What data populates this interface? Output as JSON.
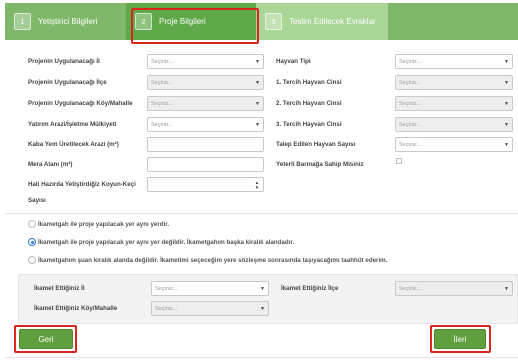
{
  "tabs": [
    {
      "num": "1",
      "label": "Yetiştirici Bilgileri"
    },
    {
      "num": "2",
      "label": "Proje Bilgileri"
    },
    {
      "num": "3",
      "label": "Teslim Edilecek Evraklar"
    }
  ],
  "left_fields": [
    {
      "label": "Projenin Uygulanacağı İl",
      "value": "Seçiniz...",
      "disabled": false
    },
    {
      "label": "Projenin Uygulanacağı İlçe",
      "value": "Seçiniz...",
      "disabled": true
    },
    {
      "label": "Projenin Uygulanacağı Köy/Mahalle",
      "value": "Seçiniz...",
      "disabled": true
    },
    {
      "label": "Yatırım Arazi/İşletme Mülkiyeti",
      "value": "Seçiniz...",
      "disabled": false
    }
  ],
  "left_inputs": {
    "kaba_yem": "Kaba Yem Üretilecek Arazi (m²)",
    "mera": "Mera Alanı (m²)",
    "hali_hazirda_line1": "Hali Hazırda Yetiştirdiğiz Koyun-Keçi",
    "hali_hazirda_line2": "Sayısı"
  },
  "right_fields": [
    {
      "label": "Hayvan Tipi",
      "value": "Seçiniz...",
      "disabled": false
    },
    {
      "label": "1. Tercih Hayvan Cinsi",
      "value": "Seçiniz...",
      "disabled": true
    },
    {
      "label": "2. Tercih Hayvan Cinsi",
      "value": "Seçiniz...",
      "disabled": true
    },
    {
      "label": "3. Tercih Hayvan Cinsi",
      "value": "Seçiniz...",
      "disabled": true
    },
    {
      "label": "Talep Edilen Hayvan Sayısı",
      "value": "Seçiniz...",
      "disabled": false
    }
  ],
  "yeterli_barinak": {
    "label": "Yeterli Barınağa Sahip Misiniz",
    "checked": false
  },
  "radios": [
    {
      "label": "İkametgah ile proje yapılacak yer aynı yerdir.",
      "checked": false
    },
    {
      "label": "İkametgah ile proje yapılacak yer aynı yer değildir. İkametgahım başka kiralık alandadır.",
      "checked": true
    },
    {
      "label": "İkametgahım şuan kiralık alanda değildir. İkametimi seçeceğim yere sözleşme sonrasında taşıyacağımı taahhüt ederim.",
      "checked": false
    }
  ],
  "ikamet": {
    "il": {
      "label": "İkamet Ettiğiniz İl",
      "value": "Seçiniz..."
    },
    "ilce": {
      "label": "İkamet Ettiğiniz İlçe",
      "value": "Seçiniz..."
    },
    "koy": {
      "label": "İkamet Ettiğiniz Köy/Mahalle",
      "value": "Seçiniz..."
    }
  },
  "buttons": {
    "back": "Geri",
    "next": "İleri"
  },
  "colors": {
    "tab_bg": "#7fb86b",
    "tab_active": "#5fa94a",
    "button": "#5f9f3e",
    "highlight": "#d9261c"
  }
}
